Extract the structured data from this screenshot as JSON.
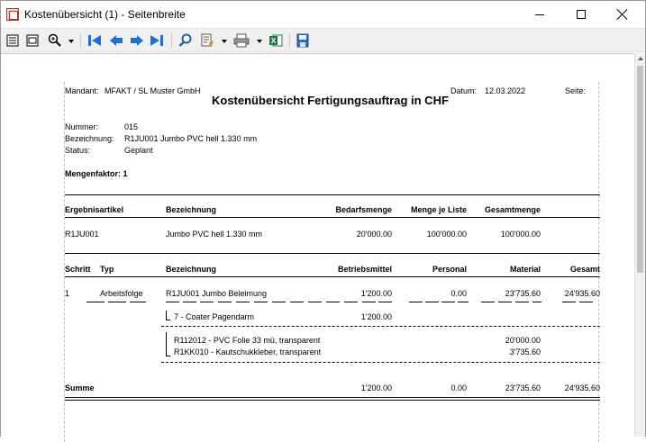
{
  "window": {
    "title": "Kostenübersicht (1) - Seitenbreite"
  },
  "toolbar": {
    "icons": [
      "page-view-icon",
      "page-width-icon",
      "zoom-icon",
      "first-page-icon",
      "previous-page-icon",
      "next-page-icon",
      "last-page-icon",
      "search-icon",
      "export-icon",
      "print-icon",
      "excel-icon",
      "save-icon"
    ]
  },
  "report": {
    "mandant_label": "Mandant:",
    "mandant_value": "MFAKT  /  SL Muster GmbH",
    "datum_label": "Datum:",
    "datum_value": "12.03.2022",
    "seite_label": "Seite:",
    "title": "Kostenübersicht Fertigungsauftrag in CHF",
    "nummer_label": "Nummer:",
    "nummer_value": "015",
    "bezeichnung_label": "Bezeichnung:",
    "bezeichnung_value": "R1JU001 Jumbo PVC hell 1.330 mm",
    "status_label": "Status:",
    "status_value": "Geplant",
    "mengenfaktor": "Mengenfaktor: 1",
    "result_headers": [
      "Ergebnisartikel",
      "Bezeichnung",
      "Bedarfsmenge",
      "Menge je Liste",
      "Gesamtmenge"
    ],
    "result_row": [
      "R1JU001",
      "Jumbo PVC hell 1.330 mm",
      "20'000.00",
      "100'000.00",
      "100'000.00"
    ],
    "step_headers": [
      "Schritt",
      "Typ",
      "Bezeichnung",
      "Betriebsmittel",
      "Personal",
      "Material",
      "Gesamt"
    ],
    "step_row": [
      "1",
      "Arbeitsfolge",
      "R1JU001 Jumbo Beleimung",
      "1'200.00",
      "0.00",
      "23'735.60",
      "24'935.60"
    ],
    "sub_resource": {
      "name": "7 - Coater Pagendarm",
      "value": "1'200.00"
    },
    "materials": [
      {
        "name": "R112012 - PVC Folie 33 mü, transparent",
        "value": "20'000.00"
      },
      {
        "name": "R1KK010 - Kautschukkleber, transparent",
        "value": "3'735.60"
      }
    ],
    "summe_label": "Summe",
    "summe_values": [
      "1'200.00",
      "0.00",
      "23'735.60",
      "24'935.60"
    ]
  }
}
